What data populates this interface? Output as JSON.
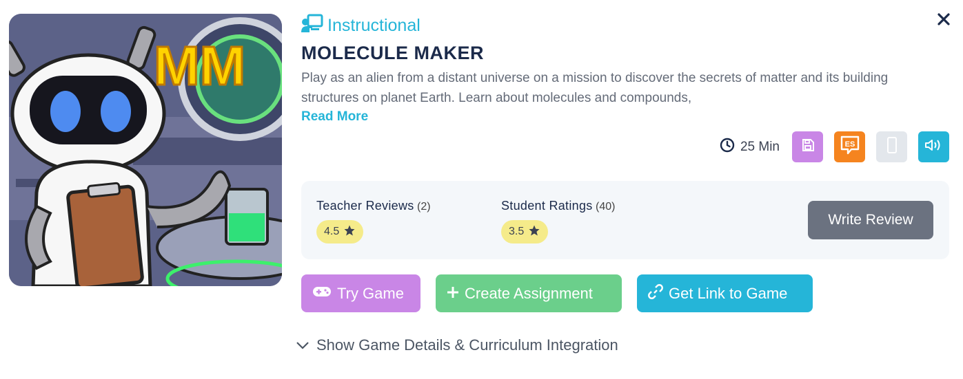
{
  "category": {
    "label": "Instructional",
    "icon": "teacher-board-icon"
  },
  "game": {
    "title": "MOLECULE MAKER",
    "description": "Play as an alien from a distant universe on a mission to discover the secrets of matter and its building structures on planet Earth. Learn about molecules and compounds,",
    "read_more": "Read More",
    "thumbnail_text": "MM"
  },
  "meta": {
    "duration": "25 Min",
    "features": [
      {
        "icon": "save-icon",
        "color": "#c986e6"
      },
      {
        "icon": "spanish-es-icon",
        "label": "ES",
        "color": "#f5841f"
      },
      {
        "icon": "mobile-icon",
        "color": "#e3e7ec"
      },
      {
        "icon": "audio-icon",
        "color": "#25b5d8"
      }
    ]
  },
  "reviews": {
    "teacher": {
      "label": "Teacher Reviews",
      "count": "(2)",
      "rating": "4.5"
    },
    "student": {
      "label": "Student Ratings",
      "count": "(40)",
      "rating": "3.5"
    },
    "write_label": "Write Review"
  },
  "actions": {
    "try": "Try Game",
    "create": "Create Assignment",
    "link": "Get Link to Game"
  },
  "details_toggle": "Show Game Details & Curriculum Integration",
  "colors": {
    "accent": "#25b5d8",
    "purple": "#c986e6",
    "green": "#6bcf8b",
    "orange": "#f5841f",
    "title": "#1b2a4a",
    "rating_pill": "#f5eb8a"
  }
}
